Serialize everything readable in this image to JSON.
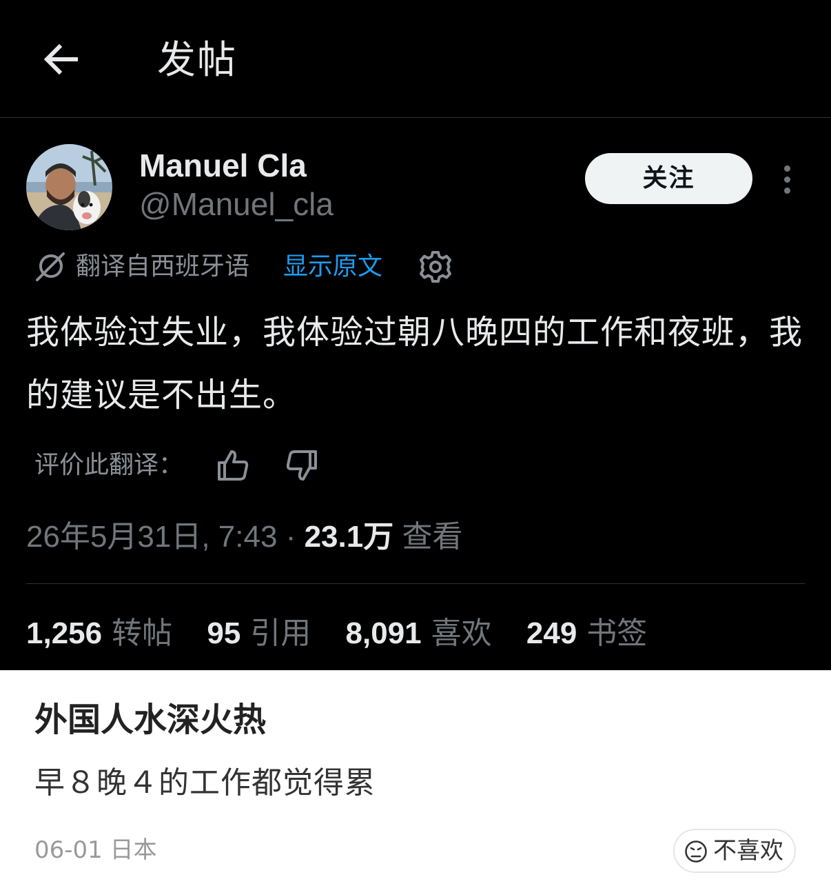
{
  "header": {
    "back_icon": "arrow-left-icon",
    "title": "发帖"
  },
  "post": {
    "author": {
      "display_name": "Manuel Cla",
      "handle": "@Manuel_cla",
      "avatar_icon": "avatar-photo"
    },
    "follow_label": "关注",
    "more_icon": "vertical-dots-icon",
    "translation": {
      "icon": "translate-icon",
      "from_label": "翻译自西班牙语",
      "show_original_label": "显示原文",
      "settings_icon": "gear-icon"
    },
    "text": "我体验过失业，我体验过朝八晚四的工作和夜班，我的建议是不出生。",
    "rating": {
      "label": "评价此翻译：",
      "thumb_up_icon": "thumbs-up-icon",
      "thumb_down_icon": "thumbs-down-icon"
    },
    "meta": {
      "datetime": "26年5月31日, 7:43",
      "separator": "·",
      "views": "23.1万",
      "views_label": "查看"
    },
    "stats": {
      "reposts": "1,256",
      "reposts_label": "转帖",
      "quotes": "95",
      "quotes_label": "引用",
      "likes": "8,091",
      "likes_label": "喜欢",
      "bookmarks": "249",
      "bookmarks_label": "书签"
    }
  },
  "comment": {
    "title": "外国人水深火热",
    "body": "早８晚４的工作都觉得累",
    "date": "06-01",
    "location": "日本",
    "dislike_icon": "frown-face-icon",
    "dislike_label": "不喜欢"
  },
  "colors": {
    "post_background": "#000000",
    "primary_text": "#e7e9ea",
    "secondary_text": "#71767b",
    "link_blue": "#1d9bf0",
    "follow_button": "#eff3f4",
    "comment_background": "#ffffff"
  }
}
